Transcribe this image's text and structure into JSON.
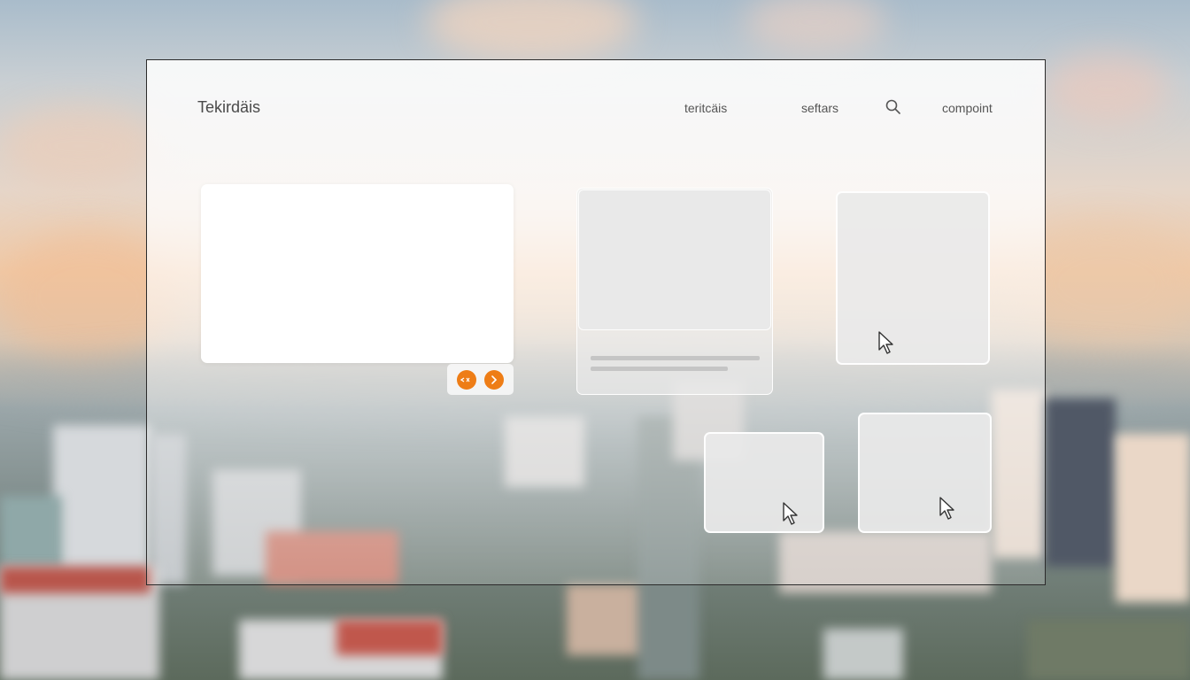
{
  "header": {
    "brand": "Tekirdäis",
    "nav": [
      {
        "label": "teritcäis"
      },
      {
        "label": "seftars"
      },
      {
        "label": "compoint"
      }
    ],
    "search_icon": "search-icon"
  },
  "carousel": {
    "prev_icon": "prev-icon",
    "next_icon": "chevron-right-icon",
    "accent_color": "#ee7d16"
  },
  "icons": {
    "cursor": "mouse-pointer-icon"
  },
  "colors": {
    "frame_border": "#2b2b2b",
    "text": "#4a4a4a"
  }
}
